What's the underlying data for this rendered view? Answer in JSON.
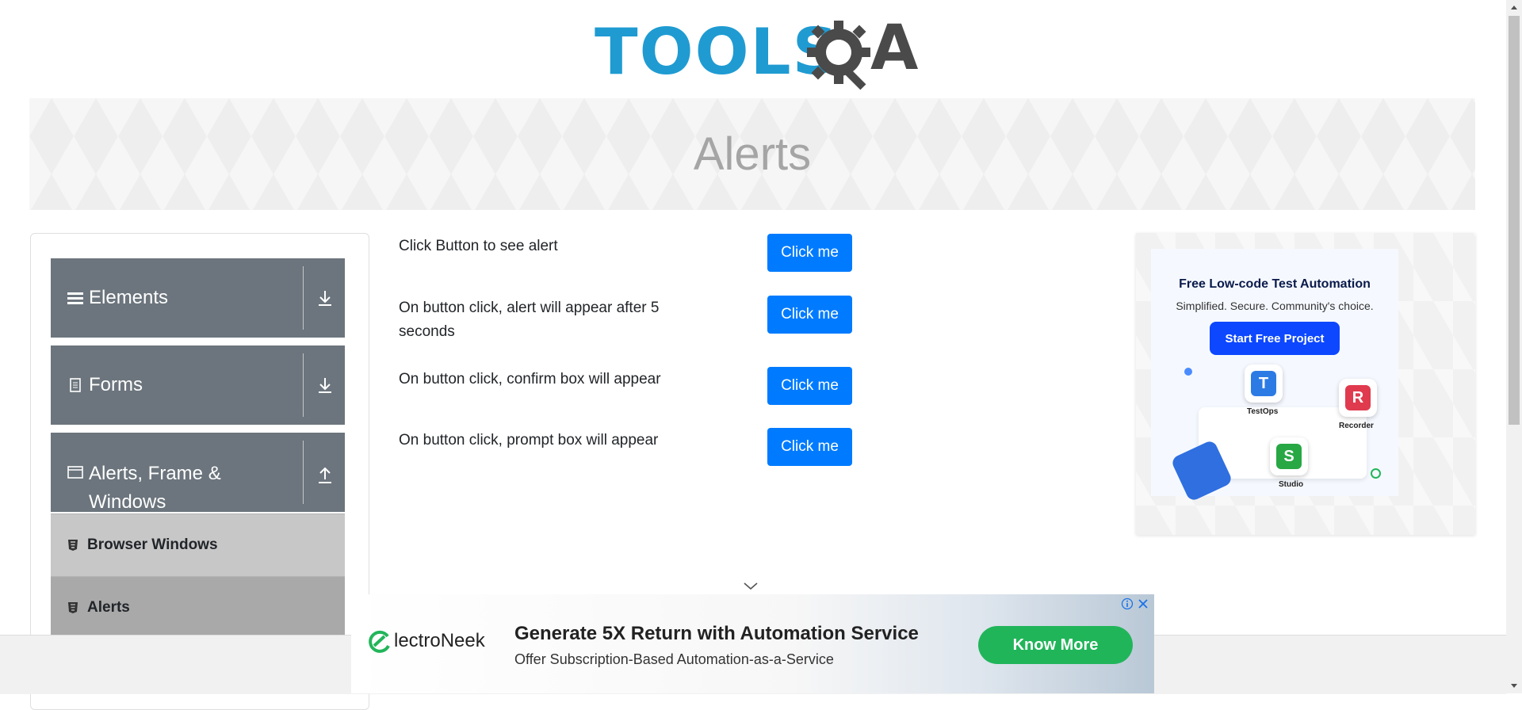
{
  "header": {
    "logo_text_primary": "TOOLS",
    "logo_text_secondary": "A",
    "logo_alt": "TOOLSQA"
  },
  "banner": {
    "title": "Alerts"
  },
  "sidebar": {
    "groups": [
      {
        "label": "Elements",
        "icon": "hamburger-icon",
        "state": "collapsed"
      },
      {
        "label": "Forms",
        "icon": "document-icon",
        "state": "collapsed"
      },
      {
        "label": "Alerts, Frame & Windows",
        "label_line1": "Alerts, Frame &",
        "label_line2": "Windows",
        "icon": "window-icon",
        "state": "expanded"
      }
    ],
    "items": [
      {
        "label": "Browser Windows",
        "active": false
      },
      {
        "label": "Alerts",
        "active": true
      }
    ]
  },
  "main": {
    "rows": [
      {
        "label": "Click Button to see alert",
        "button": "Click me"
      },
      {
        "label": "On button click, alert will appear after 5 seconds",
        "button": "Click me"
      },
      {
        "label": "On button click, confirm box will appear",
        "button": "Click me"
      },
      {
        "label": "On button click, prompt box will appear",
        "button": "Click me"
      }
    ]
  },
  "right_ad": {
    "title": "Free Low-code Test Automation",
    "subtitle": "Simplified. Secure. Community's choice.",
    "cta": "Start Free Project",
    "apps": [
      {
        "name": "TestOps",
        "letter": "T"
      },
      {
        "name": "Recorder",
        "letter": "R"
      },
      {
        "name": "Studio",
        "letter": "S"
      }
    ]
  },
  "bottom_ad": {
    "brand": "lectroNeek",
    "headline": "Generate 5X Return with Automation Service",
    "subline": "Offer Subscription-Based Automation-as-a-Service",
    "cta": "Know More"
  },
  "colors": {
    "primary_button": "#007bff",
    "sidebar_group": "#6c757d",
    "sidebar_item": "#c7c7c7",
    "sidebar_item_active": "#a9a9a9",
    "logo_blue": "#1f9bd2",
    "logo_dark": "#4a4a4a",
    "ad_cta_green": "#21b55a"
  }
}
